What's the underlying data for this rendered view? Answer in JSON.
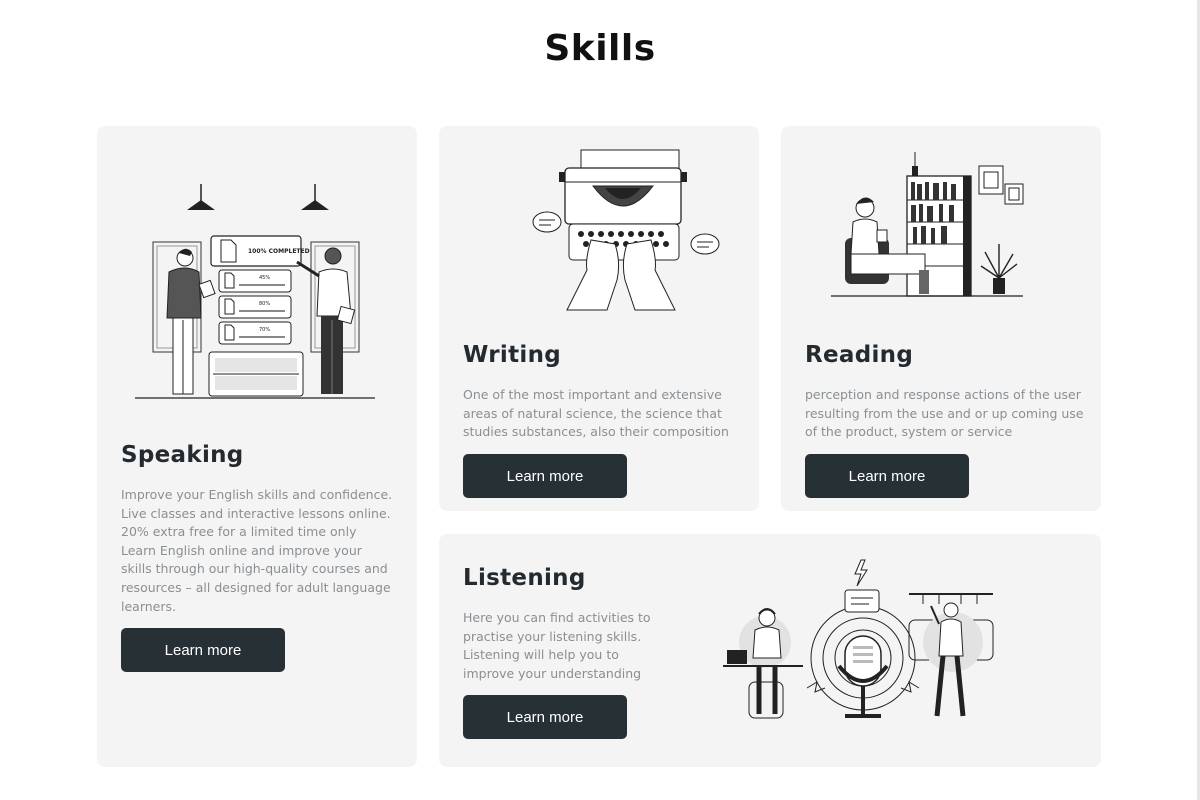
{
  "page": {
    "title": "Skills"
  },
  "cards": {
    "speaking": {
      "title": "Speaking",
      "description": "Improve your English skills and confidence. Live classes and interactive lessons online. 20% extra free for a limited time only Learn English online and improve your skills through our high-quality courses and resources – all designed for adult language learners.",
      "button": "Learn more",
      "illustration": {
        "icon": "presentation-illustration",
        "completed_label": "100% COMPLETED",
        "progress": [
          "45%",
          "80%",
          "70%"
        ]
      }
    },
    "writing": {
      "title": "Writing",
      "description": "One of the most important and extensive areas of natural science, the science that studies substances, also their composition",
      "button": "Learn more",
      "illustration": {
        "icon": "typewriter-illustration"
      }
    },
    "reading": {
      "title": "Reading",
      "description": "perception and response actions of the user resulting from the use and or up coming use of the product, system or service",
      "button": "Learn more",
      "illustration": {
        "icon": "reading-illustration"
      }
    },
    "listening": {
      "title": "Listening",
      "description": "Here you can find activities to practise your listening skills. Listening will help you to improve your understanding",
      "button": "Learn more",
      "illustration": {
        "icon": "microphone-illustration"
      }
    }
  },
  "colors": {
    "card_bg": "#f4f4f4",
    "button_bg": "#263035",
    "title": "#242b30",
    "text": "#8a8f93"
  }
}
